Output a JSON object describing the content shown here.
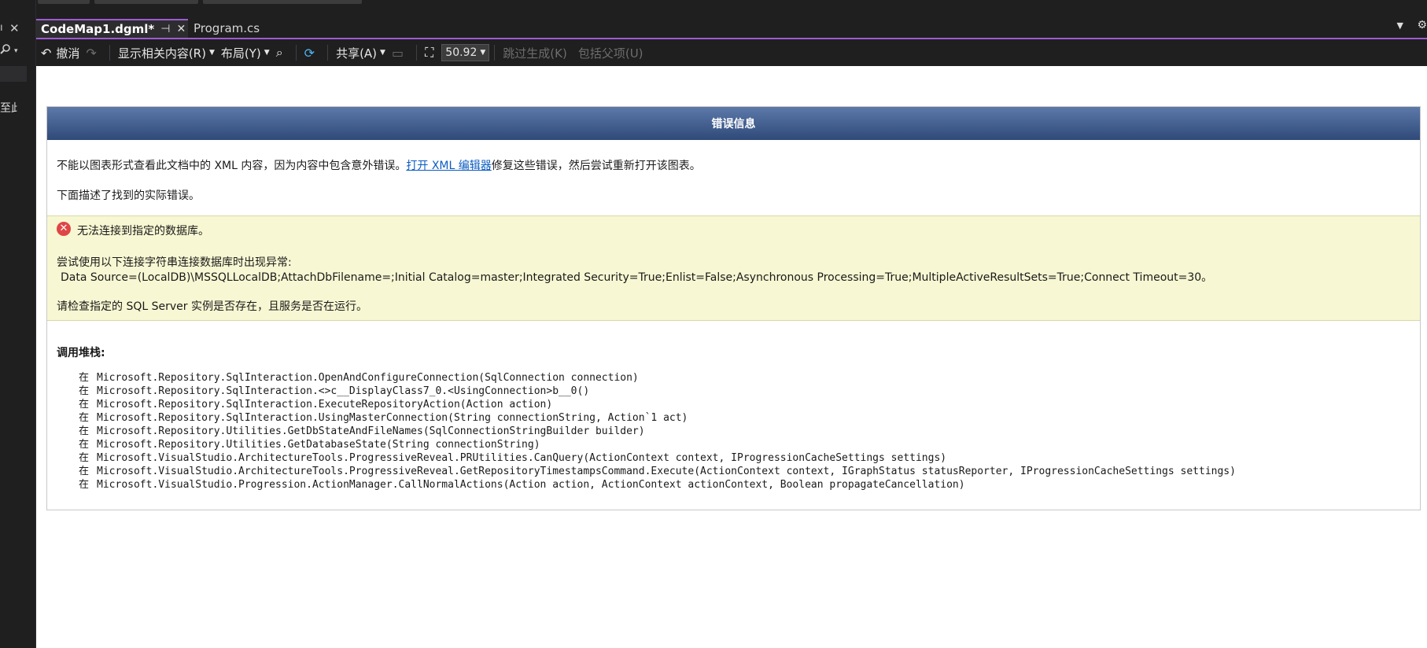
{
  "left_panel": {
    "pin_glyph": "ı",
    "close_glyph": "✕",
    "search_icon": "search-icon",
    "fragment_text": "至此"
  },
  "tabs": [
    {
      "title": "CodeMap1.dgml*",
      "active": true
    },
    {
      "title": "Program.cs",
      "active": false
    }
  ],
  "toolbar": {
    "undo_label": "撤消",
    "show_related_label": "显示相关内容(R)",
    "layout_label": "布局(Y)",
    "share_label": "共享(A)",
    "zoom_value": "50.92",
    "skip_build_label": "跳过生成(K)",
    "include_parents_label": "包括父项(U)"
  },
  "error": {
    "header": "错误信息",
    "line1_before": "不能以图表形式查看此文档中的 XML 内容，因为内容中包含意外错误。",
    "line1_link": "打开 XML 编辑器",
    "line1_after": "修复这些错误，然后尝试重新打开该图表。",
    "line2": "下面描述了找到的实际错误。",
    "box_title": "无法连接到指定的数据库。",
    "box_intro": "尝试使用以下连接字符串连接数据库时出现异常:",
    "box_connection": "Data Source=(LocalDB)\\MSSQLLocalDB;AttachDbFilename=;Initial Catalog=master;Integrated Security=True;Enlist=False;Asynchronous Processing=True;MultipleActiveResultSets=True;Connect Timeout=30。",
    "box_check": "请检查指定的 SQL Server 实例是否存在，且服务是否在运行。",
    "stack_title": "调用堆栈:",
    "stack_prefix": "在",
    "stack_frames": [
      "Microsoft.Repository.SqlInteraction.OpenAndConfigureConnection(SqlConnection connection)",
      "Microsoft.Repository.SqlInteraction.<>c__DisplayClass7_0.<UsingConnection>b__0()",
      "Microsoft.Repository.SqlInteraction.ExecuteRepositoryAction(Action action)",
      "Microsoft.Repository.SqlInteraction.UsingMasterConnection(String connectionString, Action`1 act)",
      "Microsoft.Repository.Utilities.GetDbStateAndFileNames(SqlConnectionStringBuilder builder)",
      "Microsoft.Repository.Utilities.GetDatabaseState(String connectionString)",
      "Microsoft.VisualStudio.ArchitectureTools.ProgressiveReveal.PRUtilities.CanQuery(ActionContext context, IProgressionCacheSettings settings)",
      "Microsoft.VisualStudio.ArchitectureTools.ProgressiveReveal.GetRepositoryTimestampsCommand.Execute(ActionContext context, IGraphStatus statusReporter, IProgressionCacheSettings settings)",
      "Microsoft.VisualStudio.Progression.ActionManager.CallNormalActions(Action action, ActionContext actionContext, Boolean propagateCancellation)"
    ]
  },
  "colors": {
    "accent": "#9d5bd2",
    "header_gradient_top": "#5c79aa",
    "header_gradient_bottom": "#2f4a78",
    "warning_bg": "#f7f7d3",
    "link": "#0b5cc2"
  }
}
